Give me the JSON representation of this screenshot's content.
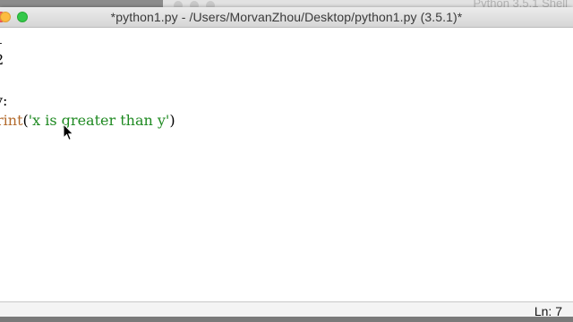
{
  "background_window": {
    "title": "Python 3.5.1 Shell"
  },
  "window": {
    "title": "*python1.py - /Users/MorvanZhou/Desktop/python1.py (3.5.1)*"
  },
  "editor": {
    "lines": [
      {
        "tokens": [
          {
            "text": "1",
            "kind": "plain"
          }
        ]
      },
      {
        "tokens": [
          {
            "text": "2",
            "kind": "plain"
          }
        ]
      },
      {
        "tokens": [
          {
            "text": "",
            "kind": "plain"
          }
        ]
      },
      {
        "tokens": [
          {
            "text": "y:",
            "kind": "plain"
          }
        ]
      },
      {
        "tokens": [
          {
            "text": "rint",
            "kind": "keyword"
          },
          {
            "text": "(",
            "kind": "plain"
          },
          {
            "text": "'x is greater than y'",
            "kind": "string"
          },
          {
            "text": ")",
            "kind": "plain"
          }
        ]
      }
    ]
  },
  "status": {
    "position": "Ln: 7"
  },
  "colors": {
    "keyword": "#b36b2d",
    "string": "#1f8a22",
    "close": "#fc605c",
    "minimize": "#fdbc40",
    "maximize": "#34c84a"
  }
}
